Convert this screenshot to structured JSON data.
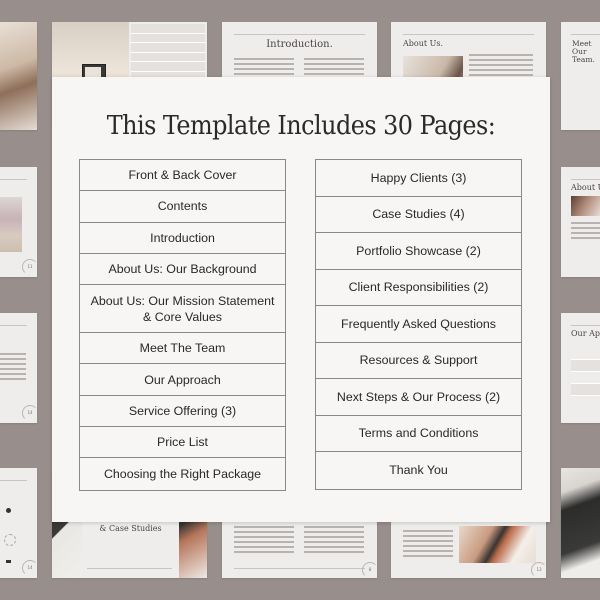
{
  "colors": {
    "background": "#988f8c",
    "card": "#f7f6f4",
    "border": "#8d8886",
    "text": "#2a2827"
  },
  "card": {
    "title": "This Template Includes 30 Pages:",
    "left_column": [
      "Front & Back Cover",
      "Contents",
      "Introduction",
      "About Us: Our Background",
      "About Us: Our Mission Statement & Core Values",
      "Meet The Team",
      "Our Approach",
      "Service Offering (3)",
      "Price List",
      "Choosing the Right Package"
    ],
    "right_column": [
      "Happy Clients (3)",
      "Case Studies (4)",
      "Portfolio Showcase (2)",
      "Client Responsibilities (2)",
      "Frequently Asked Questions",
      "Resources & Support",
      "Next Steps & Our Process (2)",
      "Terms and Conditions",
      "Thank You"
    ]
  },
  "thumbnails": {
    "introduction_title": "Introduction.",
    "about_title": "About Us.",
    "meet_title": "Meet Our Team.",
    "about_right_title": "About U",
    "approach_title": "Our Ap",
    "case_studies_title": "& Case Studies",
    "page_numbers": [
      "11",
      "14",
      "14",
      "8",
      "13"
    ]
  }
}
